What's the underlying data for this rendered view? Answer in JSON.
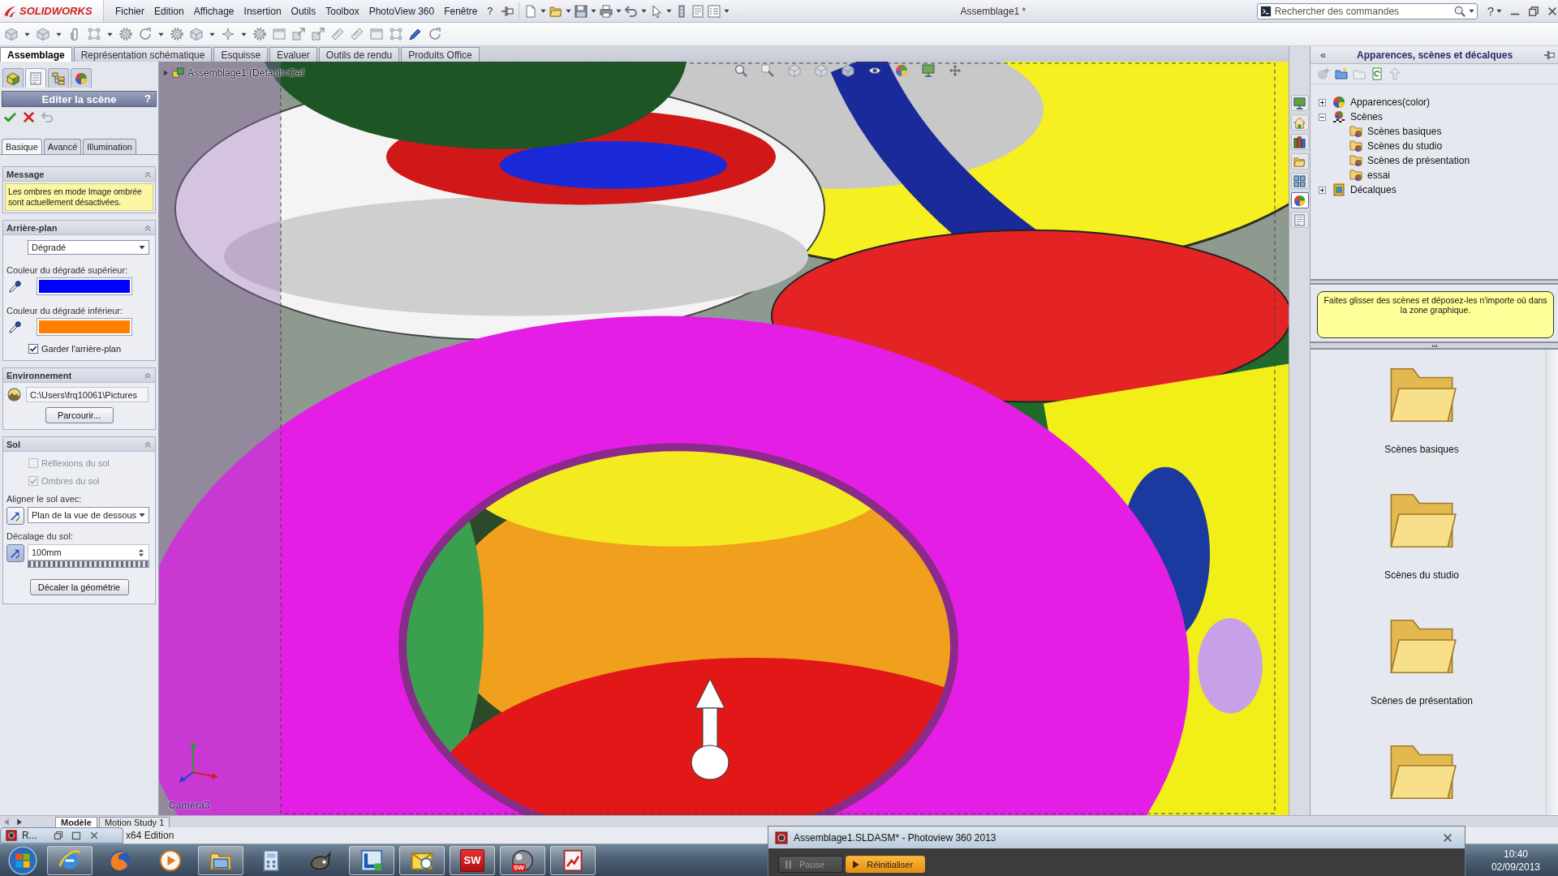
{
  "title_bar": {
    "logo": "SOLIDWORKS",
    "menus": [
      "Fichier",
      "Edition",
      "Affichage",
      "Insertion",
      "Outils",
      "Toolbox",
      "PhotoView 360",
      "Fenêtre",
      "?"
    ],
    "document_title": "Assemblage1 *",
    "search": {
      "placeholder": "Rechercher des commandes"
    },
    "help": "?"
  },
  "command_tabs": [
    {
      "label": "Assemblage",
      "selected": true
    },
    {
      "label": "Représentation schématique",
      "selected": false
    },
    {
      "label": "Esquisse",
      "selected": false
    },
    {
      "label": "Evaluer",
      "selected": false
    },
    {
      "label": "Outils de rendu",
      "selected": false
    },
    {
      "label": "Produits Office",
      "selected": false
    }
  ],
  "panel_tabs": [
    {
      "kind": "tree",
      "selected": false
    },
    {
      "kind": "properties",
      "selected": true
    },
    {
      "kind": "configurations",
      "selected": false
    },
    {
      "kind": "display",
      "selected": false
    }
  ],
  "property_manager": {
    "title": "Editer la scène",
    "help": "?",
    "tabs": [
      {
        "label": "Basique",
        "selected": true
      },
      {
        "label": "Avancé",
        "selected": false
      },
      {
        "label": "Illumination",
        "selected": false
      }
    ],
    "message": {
      "title": "Message",
      "text": "Les ombres en mode Image ombrée sont actuellement désactivées."
    },
    "background": {
      "title": "Arrière-plan",
      "type": "Dégradé",
      "top": {
        "label": "Couleur du dégradé supérieur:",
        "color": "#0000ff"
      },
      "bottom": {
        "label": "Couleur du dégradé inférieur:",
        "color": "#ff8000"
      },
      "keep": {
        "label": "Garder l'arrière-plan",
        "checked": true
      }
    },
    "environment": {
      "title": "Environnement",
      "path": "C:\\Users\\frq10061\\Pictures",
      "browse": "Parcourir..."
    },
    "floor": {
      "title": "Sol",
      "reflections": {
        "label": "Réflexions du sol",
        "checked": false,
        "disabled": true
      },
      "shadows": {
        "label": "Ombres du sol",
        "checked": true,
        "disabled": true
      },
      "align": {
        "label": "Aligner le sol avec:",
        "value": "Plan de la vue de dessous"
      },
      "offset": {
        "label": "Décalage du sol:",
        "value": "100mm"
      },
      "shift_button": "Décaler la géométrie"
    }
  },
  "viewport": {
    "tree_item": "Assemblage1 (Default<Def",
    "camera": "Caméra3"
  },
  "task_pane_tabs": [
    {
      "kind": "monitor",
      "selected": false
    },
    {
      "kind": "house",
      "selected": false
    },
    {
      "kind": "books",
      "selected": false
    },
    {
      "kind": "folder",
      "selected": false
    },
    {
      "kind": "grid",
      "selected": false
    },
    {
      "kind": "sphere",
      "selected": true
    },
    {
      "kind": "form",
      "selected": false
    }
  ],
  "appearances_panel": {
    "title": "Apparences, scènes et décalques",
    "collapse": "«",
    "tree": [
      {
        "label": "Apparences(color)",
        "kind": "appearances",
        "expanded": false
      },
      {
        "label": "Scènes",
        "kind": "scenes",
        "expanded": true,
        "children": [
          {
            "label": "Scènes basiques"
          },
          {
            "label": "Scènes du studio"
          },
          {
            "label": "Scènes de présentation"
          },
          {
            "label": "essai"
          }
        ]
      },
      {
        "label": "Décalques",
        "kind": "decals",
        "expanded": false
      }
    ],
    "tip": "Faites glisser des scènes et déposez-les n'importe où dans la zone graphique.",
    "folders": [
      {
        "kind": "folder",
        "label": "Scènes basiques"
      },
      {
        "kind": "folder",
        "label": "Scènes du studio"
      },
      {
        "kind": "folder",
        "label": "Scènes de présentation"
      },
      {
        "kind": "folder"
      }
    ]
  },
  "model_tabs": [
    {
      "label": "Modèle",
      "selected": true
    },
    {
      "label": "Motion Study 1",
      "selected": false
    }
  ],
  "status_bar": {
    "text": "x64 Edition"
  },
  "minimized_window": {
    "title": "R..."
  },
  "photoview_window": {
    "title": "Assemblage1.SLDASM* - Photoview 360 2013",
    "buttons": [
      {
        "kind": "pause",
        "label": "Pause",
        "disabled": true
      },
      {
        "kind": "reset",
        "label": "Réinitialiser",
        "disabled": false
      }
    ]
  },
  "taskbar": {
    "apps": [
      {
        "kind": "e-globe",
        "running": true
      },
      {
        "kind": "fox",
        "running": false
      },
      {
        "kind": "play",
        "running": false
      },
      {
        "kind": "folders",
        "running": true
      },
      {
        "kind": "calculator",
        "running": false
      },
      {
        "kind": "creature",
        "running": false
      },
      {
        "kind": "l-arrows",
        "running": true
      },
      {
        "kind": "envelope-clock",
        "running": true
      },
      {
        "kind": "sw-tile",
        "badge": "SW",
        "running": true
      },
      {
        "kind": "sw-sphere",
        "badge": "SW",
        "running": true
      },
      {
        "kind": "chart-doc",
        "running": true
      }
    ],
    "clock": {
      "time": "10:40",
      "date": "02/09/2013"
    }
  }
}
